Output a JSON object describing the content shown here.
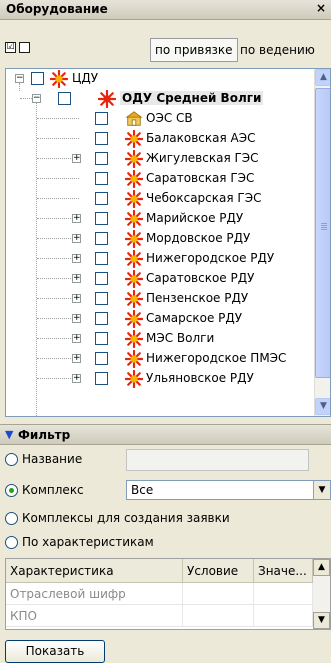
{
  "panel": {
    "title": "Оборудование",
    "close_glyph": "×"
  },
  "toolbar": {
    "check_all_glyph": "☑",
    "uncheck_all_glyph": "",
    "by_binding_label": "по привязке",
    "by_management_label": "по ведению"
  },
  "tree": {
    "root": {
      "label": "ЦДУ",
      "icon": "sun-icon"
    },
    "child": {
      "label": "ОДУ Средней Волги",
      "icon": "sun-icon"
    },
    "items": [
      {
        "label": "ОЭС СВ",
        "icon": "building-icon",
        "expandable": false
      },
      {
        "label": "Балаковская АЭС",
        "icon": "sun-icon",
        "expandable": false
      },
      {
        "label": "Жигулевская ГЭС",
        "icon": "sun-icon",
        "expandable": true
      },
      {
        "label": "Саратовская ГЭС",
        "icon": "sun-icon",
        "expandable": false
      },
      {
        "label": "Чебоксарская ГЭС",
        "icon": "sun-icon",
        "expandable": false
      },
      {
        "label": "Марийское РДУ",
        "icon": "sun-icon",
        "expandable": true
      },
      {
        "label": "Мордовское РДУ",
        "icon": "sun-icon",
        "expandable": true
      },
      {
        "label": "Нижегородское РДУ",
        "icon": "sun-icon",
        "expandable": true
      },
      {
        "label": "Саратовское РДУ",
        "icon": "sun-icon",
        "expandable": true
      },
      {
        "label": "Пензенское РДУ",
        "icon": "sun-icon",
        "expandable": true
      },
      {
        "label": "Самарское РДУ",
        "icon": "sun-icon",
        "expandable": true
      },
      {
        "label": "МЭС Волги",
        "icon": "sun-icon",
        "expandable": true
      },
      {
        "label": "Нижегородское ПМЭС",
        "icon": "sun-icon",
        "expandable": true
      },
      {
        "label": "Ульяновское РДУ",
        "icon": "sun-icon",
        "expandable": true
      }
    ]
  },
  "filter": {
    "title": "Фильтр",
    "name_label": "Название",
    "name_value": "",
    "complex_label": "Комплекс",
    "complex_value": "Все",
    "complexes_label": "Комплексы для создания заявки",
    "by_characteristics_label": "По характеристикам",
    "selected": "complex"
  },
  "grid": {
    "columns": [
      "Характеристика",
      "Условие",
      "Значе..."
    ],
    "rows": [
      [
        "Отраслевой шифр",
        "",
        ""
      ],
      [
        "КПО",
        "",
        ""
      ]
    ]
  },
  "actions": {
    "show_label": "Показать"
  },
  "colors": {
    "sun_icon": "#e8250c",
    "sun_icon_core": "#f5b400",
    "selection": "#21a121"
  }
}
